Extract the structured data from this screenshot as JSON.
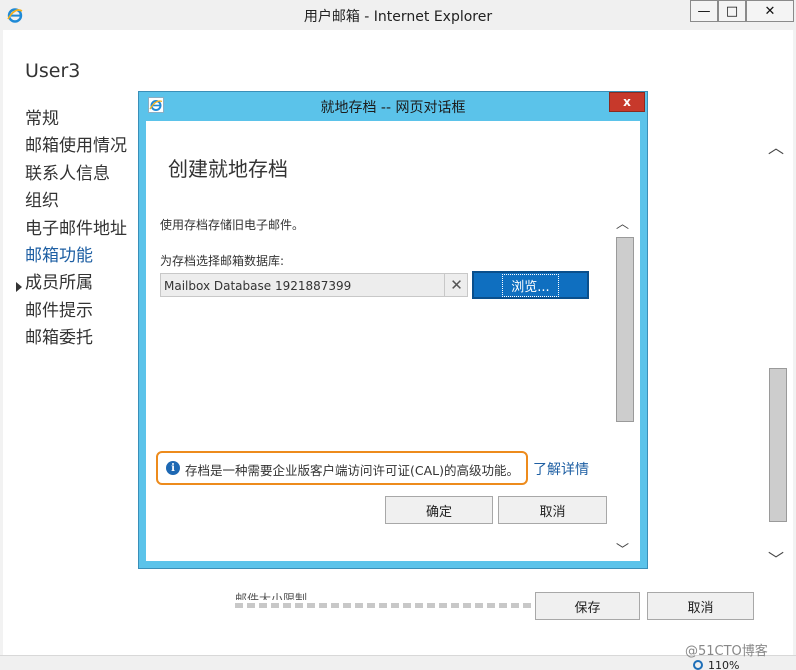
{
  "window": {
    "title": "用户邮箱 - Internet Explorer",
    "minimize_glyph": "—",
    "maximize_glyph": "□",
    "close_glyph": "✕"
  },
  "page": {
    "user_name": "User3",
    "nav_items": [
      {
        "label": "常规"
      },
      {
        "label": "邮箱使用情况"
      },
      {
        "label": "联系人信息"
      },
      {
        "label": "组织"
      },
      {
        "label": "电子邮件地址"
      },
      {
        "label": "邮箱功能",
        "active": true
      },
      {
        "label": "成员所属"
      },
      {
        "label": "邮件提示"
      },
      {
        "label": "邮箱委托"
      }
    ],
    "background_text": "邮件大小限制",
    "save_label": "保存",
    "cancel_label": "取消",
    "scroll_up_glyph": "︿",
    "scroll_down_glyph": "﹀"
  },
  "dialog": {
    "title": "就地存档 -- 网页对话框",
    "close_glyph": "x",
    "heading": "创建就地存档",
    "description": "使用存档存储旧电子邮件。",
    "db_label": "为存档选择邮箱数据库:",
    "db_value": "Mailbox Database 1921887399",
    "clear_glyph": "✕",
    "browse_label": "浏览...",
    "notice_icon_glyph": "i",
    "notice": "存档是一种需要企业版客户端访问许可证(CAL)的高级功能。",
    "learn_more": "了解详情",
    "ok_label": "确定",
    "cancel_label": "取消"
  },
  "status": {
    "zoom": "110%"
  },
  "watermark": "@51CTO博客",
  "colors": {
    "dialog_frame": "#5bc3ea",
    "primary_button": "#0f6fc0",
    "notice_outline": "#ed8b1c",
    "link": "#1e5fa3",
    "close_red": "#c7392b"
  },
  "icons": {
    "app_logo": "internet-explorer-icon",
    "info": "info-icon"
  }
}
